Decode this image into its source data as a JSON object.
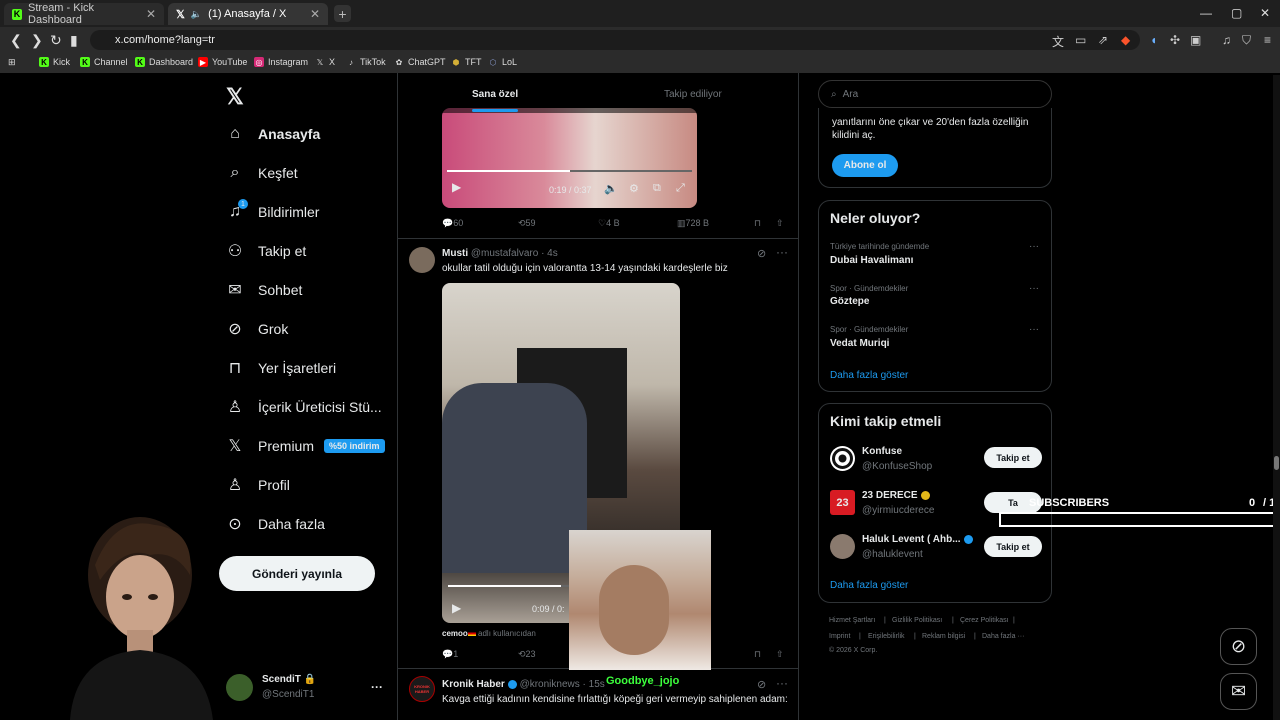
{
  "browser": {
    "tabs": [
      {
        "title": "Stream - Kick Dashboard"
      },
      {
        "title": "(1) Anasayfa / X"
      }
    ],
    "url": "x.com/home?lang=tr",
    "bookmarks": [
      "Kick",
      "Channel",
      "Dashboard",
      "YouTube",
      "Instagram",
      "X",
      "TikTok",
      "ChatGPT",
      "TFT",
      "LoL"
    ]
  },
  "nav": {
    "items": [
      {
        "label": "Anasayfa",
        "icon": "home-icon"
      },
      {
        "label": "Keşfet",
        "icon": "search-icon"
      },
      {
        "label": "Bildirimler",
        "icon": "bell-icon",
        "badge": "1"
      },
      {
        "label": "Takip et",
        "icon": "add-user-icon"
      },
      {
        "label": "Sohbet",
        "icon": "mail-icon"
      },
      {
        "label": "Grok",
        "icon": "grok-icon"
      },
      {
        "label": "Yer İşaretleri",
        "icon": "bookmark-icon"
      },
      {
        "label": "İçerik Üreticisi Stü...",
        "icon": "creator-icon"
      },
      {
        "label": "Premium",
        "icon": "x-icon",
        "badge": "%50 indirim"
      },
      {
        "label": "Profil",
        "icon": "person-icon"
      },
      {
        "label": "Daha fazla",
        "icon": "more-circle-icon"
      }
    ],
    "post_button": "Gönderi yayınla",
    "account": {
      "name": "ScendiT",
      "handle": "@ScendiT1"
    }
  },
  "feed": {
    "tabs": [
      "Sana özel",
      "Takip ediliyor"
    ],
    "first_video_time": "0:19 / 0:37",
    "first_actions": {
      "replies": "60",
      "reposts": "59",
      "likes": "4 B",
      "views": "728 B"
    },
    "tweet2": {
      "name": "Musti",
      "handle": "@mustafalvaro",
      "time": "· 4s",
      "text": "okullar tatil olduğu için valorantta 13-14 yaşındaki kardeşlerle biz",
      "video_time": "0:09 / 0:",
      "tag_user": "cemoo",
      "tag_suffix": "adlı kullanıcıdan",
      "replies": "1",
      "reposts": "23"
    },
    "tweet3": {
      "name": "Kronik Haber",
      "handle": "@kroniknews",
      "time": "· 15s",
      "text": "Kavga ettiği kadının kendisine fırlattığı köpeği geri vermeyip sahiplenen adam:",
      "avatar_text": "KRONIK HABER"
    }
  },
  "overlay": {
    "username": "Goodbye_jojo",
    "subscribers_label": "SUBSCRIBERS",
    "subscribers_count": "0",
    "subscribers_goal": "/ 1",
    "follow_partial": "Ta"
  },
  "sidebar": {
    "search_placeholder": "Ara",
    "premium_text": "yanıtlarını öne çıkar ve 20'den fazla özelliğin kilidini aç.",
    "premium_button": "Abone ol",
    "trends_title": "Neler oluyor?",
    "trends": [
      {
        "category": "Türkiye tarihinde gündemde",
        "name": "Dubai Havalimanı"
      },
      {
        "category": "Spor · Gündemdekiler",
        "name": "Göztepe"
      },
      {
        "category": "Spor · Gündemdekiler",
        "name": "Vedat Muriqi"
      }
    ],
    "show_more": "Daha fazla göster",
    "who_title": "Kimi takip etmeli",
    "who": [
      {
        "name": "Konfuse",
        "handle": "@KonfuseShop",
        "button": "Takip et"
      },
      {
        "name": "23 DERECE",
        "handle": "@yirmiucderece",
        "button": "Takip et"
      },
      {
        "name": "Haluk Levent ( Ahb...",
        "handle": "@haluklevent",
        "button": "Takip et"
      }
    ],
    "who_show_more": "Daha fazla göster",
    "footer": [
      "Hizmet Şartları",
      "Gizlilik Politikası",
      "Çerez Politikası",
      "Imprint",
      "Erişilebilirlik",
      "Reklam bilgisi",
      "Daha fazla ···",
      "© 2026 X Corp."
    ]
  },
  "colors": {
    "accent": "#1d9bf0",
    "kick": "#53fc18",
    "overlay_name": "#3cff3c"
  }
}
